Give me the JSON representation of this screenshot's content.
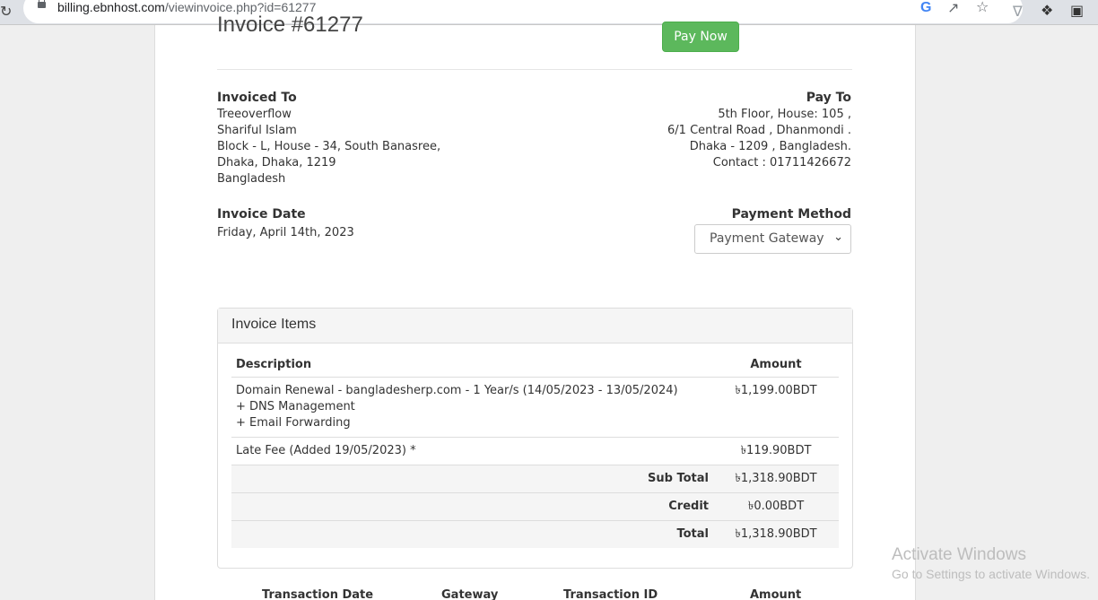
{
  "browser": {
    "url_domain": "billing.ebnhost.com",
    "url_path": "/viewinvoice.php?id=61277"
  },
  "invoice": {
    "title": "Invoice #61277",
    "pay_now_label": "Pay Now",
    "invoiced_to_heading": "Invoiced To",
    "invoiced_to": [
      "Treeoverflow",
      "Shariful Islam",
      "Block - L, House - 34, South Banasree,",
      "Dhaka, Dhaka, 1219",
      "Bangladesh"
    ],
    "pay_to_heading": "Pay To",
    "pay_to": [
      "5th Floor, House: 105 ,",
      "6/1 Central Road , Dhanmondi .",
      "Dhaka - 1209 , Bangladesh.",
      "Contact : 01711426672"
    ],
    "invoice_date_heading": "Invoice Date",
    "invoice_date": "Friday, April 14th, 2023",
    "payment_method_heading": "Payment Method",
    "payment_method_selected": "Payment Gateway"
  },
  "items": {
    "panel_title": "Invoice Items",
    "col_description": "Description",
    "col_amount": "Amount",
    "rows": [
      {
        "desc": [
          "Domain Renewal - bangladesherp.com - 1 Year/s (14/05/2023 - 13/05/2024)",
          "+ DNS Management",
          "+ Email Forwarding"
        ],
        "amount": "৳1,199.00BDT"
      },
      {
        "desc": [
          "Late Fee (Added 19/05/2023) *"
        ],
        "amount": "৳119.90BDT"
      }
    ],
    "summary": [
      {
        "label": "Sub Total",
        "amount": "৳1,318.90BDT"
      },
      {
        "label": "Credit",
        "amount": "৳0.00BDT"
      },
      {
        "label": "Total",
        "amount": "৳1,318.90BDT"
      }
    ]
  },
  "transactions": {
    "col_date": "Transaction Date",
    "col_gateway": "Gateway",
    "col_id": "Transaction ID",
    "col_amount": "Amount"
  },
  "watermark": {
    "line1": "Activate Windows",
    "line2": "Go to Settings to activate Windows."
  }
}
